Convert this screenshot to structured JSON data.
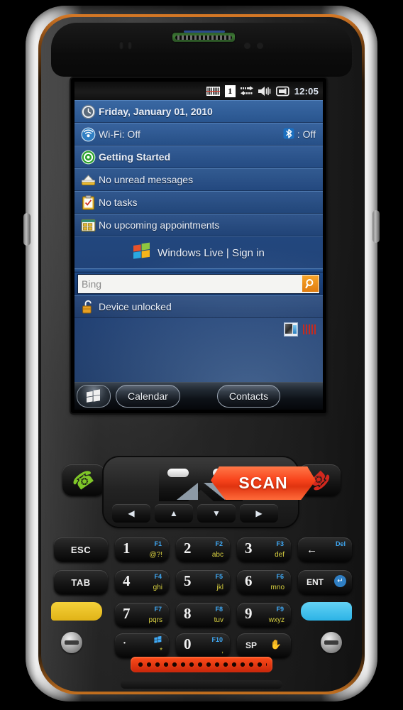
{
  "device": {
    "name": "rugged-handheld-terminal",
    "brand_accent": "#e06000",
    "body_color": "#2a2a2a"
  },
  "screen": {
    "statusbar": {
      "icons": [
        {
          "name": "barcode-scanner-icon",
          "glyph": "barcode"
        },
        {
          "name": "sim-indicator-icon",
          "glyph": "1"
        },
        {
          "name": "connectivity-icon",
          "glyph": "arrows"
        },
        {
          "name": "volume-mute-icon",
          "glyph": "speaker"
        },
        {
          "name": "battery-power-icon",
          "glyph": "battery"
        }
      ],
      "time": "12:05"
    },
    "today_rows": [
      {
        "icon": "clock-icon",
        "label": "Friday, January 01, 2010",
        "bold": true
      },
      {
        "icon": "wifi-icon",
        "label": "Wi-Fi: Off",
        "right_label": ": Off",
        "right_icon": "bluetooth-icon",
        "bold": false
      },
      {
        "icon": "getting-started-icon",
        "label": "Getting Started",
        "bold": true
      },
      {
        "icon": "messaging-icon",
        "label": "No unread messages",
        "bold": false
      },
      {
        "icon": "tasks-icon",
        "label": "No tasks",
        "bold": false
      },
      {
        "icon": "calendar-icon",
        "label": "No upcoming appointments",
        "bold": false
      }
    ],
    "windows_live": {
      "icon": "windows-logo-icon",
      "label": "Windows Live  |  Sign in"
    },
    "search": {
      "placeholder": "Bing",
      "value": "",
      "go_icon": "search-icon"
    },
    "lock_row": {
      "icon": "unlocked-padlock-icon",
      "label": "Device unlocked"
    },
    "tray": [
      {
        "name": "tray-app-icon",
        "label": ""
      },
      {
        "name": "tray-barcode-icon",
        "label": ""
      }
    ],
    "taskbar": {
      "start": "start-button",
      "left_button": "Calendar",
      "right_button": "Contacts"
    }
  },
  "keypad": {
    "scan_label": "SCAN",
    "call_keys": [
      {
        "name": "call-send-key",
        "glyph": "handset",
        "color": "#7fc728"
      },
      {
        "name": "call-end-key",
        "glyph": "handset",
        "color": "#d3281e"
      }
    ],
    "nav": {
      "left_soft": "side-scan-left-key",
      "right_soft": "side-scan-right-key",
      "dpad": [
        {
          "name": "dpad-left-key",
          "glyph": "◀"
        },
        {
          "name": "dpad-up-key",
          "glyph": "▲"
        },
        {
          "name": "dpad-down-key",
          "glyph": "▼"
        },
        {
          "name": "dpad-right-key",
          "glyph": "▶"
        }
      ]
    },
    "rows": [
      [
        {
          "name": "esc-key",
          "label": "ESC",
          "type": "text"
        },
        {
          "name": "key-1",
          "num": "1",
          "fn": "F1",
          "abc": "@?!",
          "type": "num"
        },
        {
          "name": "key-2",
          "num": "2",
          "fn": "F2",
          "abc": "abc",
          "type": "num"
        },
        {
          "name": "key-3",
          "num": "3",
          "fn": "F3",
          "abc": "def",
          "type": "num"
        },
        {
          "name": "backspace-key",
          "label": "Del",
          "glyph": "←",
          "type": "del"
        }
      ],
      [
        {
          "name": "tab-key",
          "label": "TAB",
          "type": "text"
        },
        {
          "name": "key-4",
          "num": "4",
          "fn": "F4",
          "abc": "ghi",
          "type": "num"
        },
        {
          "name": "key-5",
          "num": "5",
          "fn": "F5",
          "abc": "jkl",
          "type": "num"
        },
        {
          "name": "key-6",
          "num": "6",
          "fn": "F6",
          "abc": "mno",
          "type": "num"
        },
        {
          "name": "enter-key",
          "label": "ENT",
          "type": "ent"
        }
      ],
      [
        {
          "name": "yellow-soft-key",
          "label": "",
          "type": "color-yellow"
        },
        {
          "name": "key-7",
          "num": "7",
          "fn": "F7",
          "abc": "pqrs",
          "type": "num"
        },
        {
          "name": "key-8",
          "num": "8",
          "fn": "F8",
          "abc": "tuv",
          "type": "num"
        },
        {
          "name": "key-9",
          "num": "9",
          "fn": "F9",
          "abc": "wxyz",
          "type": "num"
        },
        {
          "name": "blue-soft-key",
          "label": "",
          "type": "color-blue"
        }
      ],
      [
        {
          "name": "key-star",
          "num": "·",
          "fn": "",
          "abc": "*",
          "type": "star"
        },
        {
          "name": "key-0",
          "num": "0",
          "fn": "F10",
          "abc": ",",
          "type": "num"
        },
        {
          "name": "space-key",
          "label": "SP",
          "type": "sp"
        }
      ]
    ]
  }
}
